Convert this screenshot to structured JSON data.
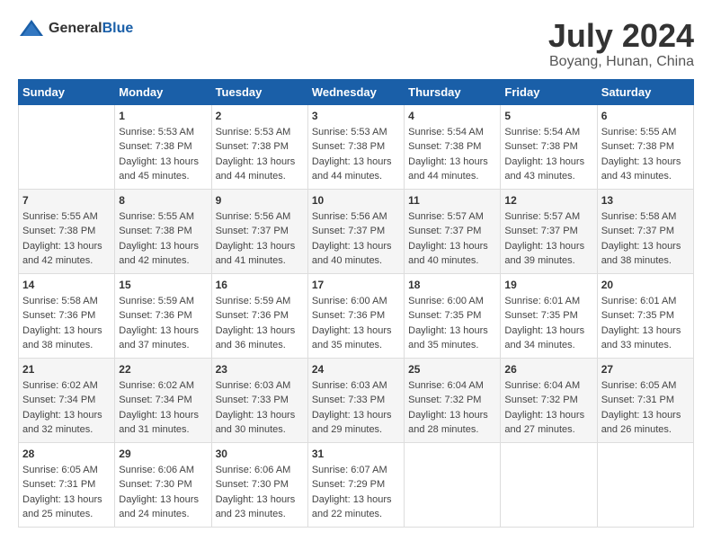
{
  "header": {
    "logo_general": "General",
    "logo_blue": "Blue",
    "month_year": "July 2024",
    "location": "Boyang, Hunan, China"
  },
  "days_of_week": [
    "Sunday",
    "Monday",
    "Tuesday",
    "Wednesday",
    "Thursday",
    "Friday",
    "Saturday"
  ],
  "weeks": [
    [
      {
        "day": "",
        "info": ""
      },
      {
        "day": "1",
        "info": "Sunrise: 5:53 AM\nSunset: 7:38 PM\nDaylight: 13 hours\nand 45 minutes."
      },
      {
        "day": "2",
        "info": "Sunrise: 5:53 AM\nSunset: 7:38 PM\nDaylight: 13 hours\nand 44 minutes."
      },
      {
        "day": "3",
        "info": "Sunrise: 5:53 AM\nSunset: 7:38 PM\nDaylight: 13 hours\nand 44 minutes."
      },
      {
        "day": "4",
        "info": "Sunrise: 5:54 AM\nSunset: 7:38 PM\nDaylight: 13 hours\nand 44 minutes."
      },
      {
        "day": "5",
        "info": "Sunrise: 5:54 AM\nSunset: 7:38 PM\nDaylight: 13 hours\nand 43 minutes."
      },
      {
        "day": "6",
        "info": "Sunrise: 5:55 AM\nSunset: 7:38 PM\nDaylight: 13 hours\nand 43 minutes."
      }
    ],
    [
      {
        "day": "7",
        "info": "Sunrise: 5:55 AM\nSunset: 7:38 PM\nDaylight: 13 hours\nand 42 minutes."
      },
      {
        "day": "8",
        "info": "Sunrise: 5:55 AM\nSunset: 7:38 PM\nDaylight: 13 hours\nand 42 minutes."
      },
      {
        "day": "9",
        "info": "Sunrise: 5:56 AM\nSunset: 7:37 PM\nDaylight: 13 hours\nand 41 minutes."
      },
      {
        "day": "10",
        "info": "Sunrise: 5:56 AM\nSunset: 7:37 PM\nDaylight: 13 hours\nand 40 minutes."
      },
      {
        "day": "11",
        "info": "Sunrise: 5:57 AM\nSunset: 7:37 PM\nDaylight: 13 hours\nand 40 minutes."
      },
      {
        "day": "12",
        "info": "Sunrise: 5:57 AM\nSunset: 7:37 PM\nDaylight: 13 hours\nand 39 minutes."
      },
      {
        "day": "13",
        "info": "Sunrise: 5:58 AM\nSunset: 7:37 PM\nDaylight: 13 hours\nand 38 minutes."
      }
    ],
    [
      {
        "day": "14",
        "info": "Sunrise: 5:58 AM\nSunset: 7:36 PM\nDaylight: 13 hours\nand 38 minutes."
      },
      {
        "day": "15",
        "info": "Sunrise: 5:59 AM\nSunset: 7:36 PM\nDaylight: 13 hours\nand 37 minutes."
      },
      {
        "day": "16",
        "info": "Sunrise: 5:59 AM\nSunset: 7:36 PM\nDaylight: 13 hours\nand 36 minutes."
      },
      {
        "day": "17",
        "info": "Sunrise: 6:00 AM\nSunset: 7:36 PM\nDaylight: 13 hours\nand 35 minutes."
      },
      {
        "day": "18",
        "info": "Sunrise: 6:00 AM\nSunset: 7:35 PM\nDaylight: 13 hours\nand 35 minutes."
      },
      {
        "day": "19",
        "info": "Sunrise: 6:01 AM\nSunset: 7:35 PM\nDaylight: 13 hours\nand 34 minutes."
      },
      {
        "day": "20",
        "info": "Sunrise: 6:01 AM\nSunset: 7:35 PM\nDaylight: 13 hours\nand 33 minutes."
      }
    ],
    [
      {
        "day": "21",
        "info": "Sunrise: 6:02 AM\nSunset: 7:34 PM\nDaylight: 13 hours\nand 32 minutes."
      },
      {
        "day": "22",
        "info": "Sunrise: 6:02 AM\nSunset: 7:34 PM\nDaylight: 13 hours\nand 31 minutes."
      },
      {
        "day": "23",
        "info": "Sunrise: 6:03 AM\nSunset: 7:33 PM\nDaylight: 13 hours\nand 30 minutes."
      },
      {
        "day": "24",
        "info": "Sunrise: 6:03 AM\nSunset: 7:33 PM\nDaylight: 13 hours\nand 29 minutes."
      },
      {
        "day": "25",
        "info": "Sunrise: 6:04 AM\nSunset: 7:32 PM\nDaylight: 13 hours\nand 28 minutes."
      },
      {
        "day": "26",
        "info": "Sunrise: 6:04 AM\nSunset: 7:32 PM\nDaylight: 13 hours\nand 27 minutes."
      },
      {
        "day": "27",
        "info": "Sunrise: 6:05 AM\nSunset: 7:31 PM\nDaylight: 13 hours\nand 26 minutes."
      }
    ],
    [
      {
        "day": "28",
        "info": "Sunrise: 6:05 AM\nSunset: 7:31 PM\nDaylight: 13 hours\nand 25 minutes."
      },
      {
        "day": "29",
        "info": "Sunrise: 6:06 AM\nSunset: 7:30 PM\nDaylight: 13 hours\nand 24 minutes."
      },
      {
        "day": "30",
        "info": "Sunrise: 6:06 AM\nSunset: 7:30 PM\nDaylight: 13 hours\nand 23 minutes."
      },
      {
        "day": "31",
        "info": "Sunrise: 6:07 AM\nSunset: 7:29 PM\nDaylight: 13 hours\nand 22 minutes."
      },
      {
        "day": "",
        "info": ""
      },
      {
        "day": "",
        "info": ""
      },
      {
        "day": "",
        "info": ""
      }
    ]
  ]
}
